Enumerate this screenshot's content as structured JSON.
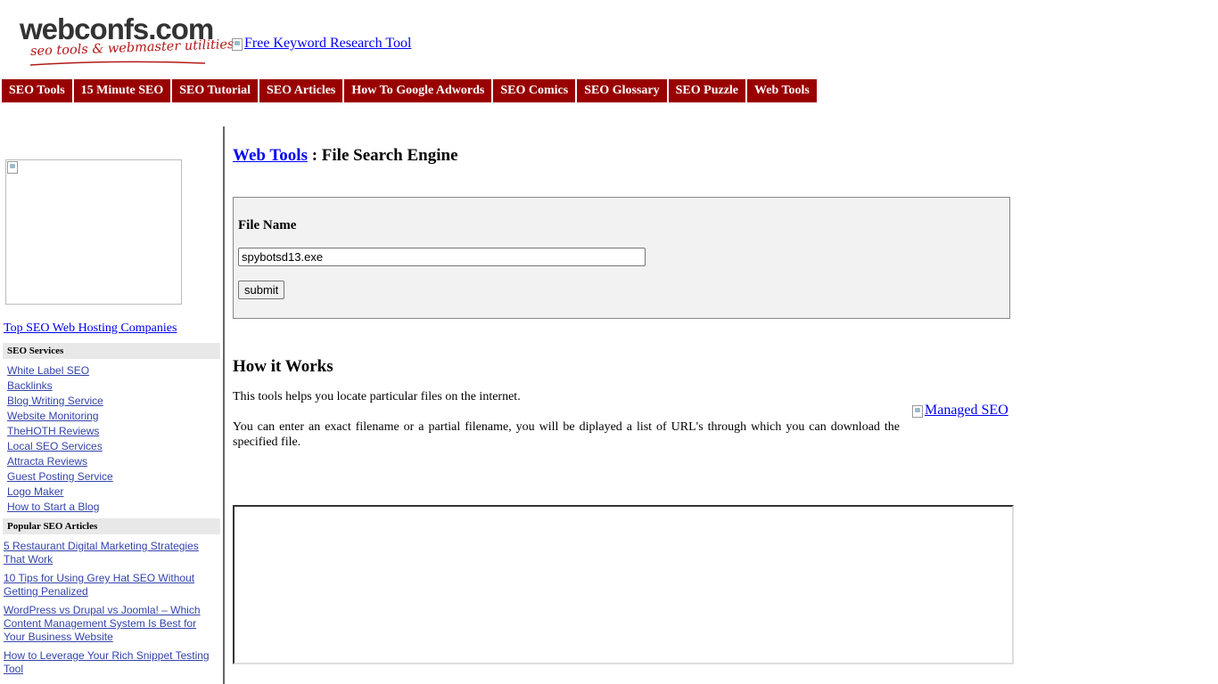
{
  "header": {
    "logo_brand": "webconfs.com",
    "logo_tagline": "seo tools & webmaster utilities",
    "banner_alt": "Free Keyword Research Tool"
  },
  "nav": [
    {
      "label": "SEO Tools"
    },
    {
      "label": "15 Minute SEO"
    },
    {
      "label": "SEO Tutorial"
    },
    {
      "label": "SEO Articles"
    },
    {
      "label": "How To Google Adwords"
    },
    {
      "label": "SEO Comics"
    },
    {
      "label": "SEO Glossary"
    },
    {
      "label": "SEO Puzzle"
    },
    {
      "label": "Web Tools"
    }
  ],
  "sidebar": {
    "hosting_link": "Top SEO Web Hosting Companies",
    "services_heading": "SEO Services",
    "services": [
      {
        "label": "White Label SEO"
      },
      {
        "label": "Backlinks"
      },
      {
        "label": "Blog Writing Service"
      },
      {
        "label": "Website Monitoring"
      },
      {
        "label": "TheHOTH Reviews"
      },
      {
        "label": "Local SEO Services"
      },
      {
        "label": "Attracta Reviews"
      },
      {
        "label": "Guest Posting Service"
      },
      {
        "label": "Logo Maker"
      },
      {
        "label": "How to Start a Blog"
      }
    ],
    "articles_heading": "Popular SEO Articles",
    "articles": [
      {
        "label": " 5 Restaurant Digital Marketing Strategies That Work"
      },
      {
        "label": " 10 Tips for Using Grey Hat SEO Without Getting Penalized"
      },
      {
        "label": " WordPress vs Drupal vs Joomla! – Which Content Management System Is Best for Your Business Website"
      },
      {
        "label": " How to Leverage Your Rich Snippet Testing Tool"
      }
    ]
  },
  "main": {
    "breadcrumb_link": "Web Tools",
    "title_suffix": " : File Search Engine",
    "form": {
      "label": "File Name",
      "input_value": "spybotsd13.exe",
      "submit_label": "submit"
    },
    "how_heading": "How it Works",
    "how_p1": "This tools helps you locate particular files on the internet.",
    "how_p2": "You can enter an exact filename or a partial filename, you will be diplayed a list of URL's through which you can download the specified file.",
    "managed_seo_alt": "Managed SEO"
  },
  "colors": {
    "nav_bg": "#990000",
    "link": "#0000ee",
    "sidebar_link": "#3344aa",
    "form_bg": "#f2f2f2"
  }
}
